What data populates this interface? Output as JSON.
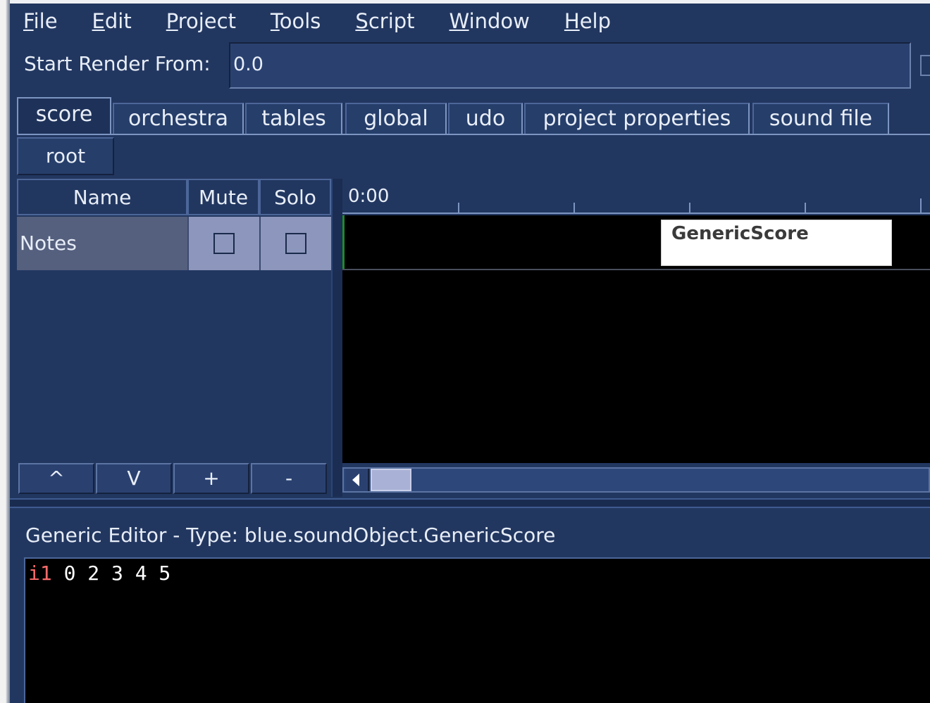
{
  "menu": {
    "items": [
      {
        "mnemonic": "F",
        "rest": "ile"
      },
      {
        "mnemonic": "E",
        "rest": "dit"
      },
      {
        "mnemonic": "P",
        "rest": "roject"
      },
      {
        "mnemonic": "T",
        "rest": "ools"
      },
      {
        "mnemonic": "S",
        "rest": "cript"
      },
      {
        "mnemonic": "W",
        "rest": "indow"
      },
      {
        "mnemonic": "H",
        "rest": "elp"
      }
    ]
  },
  "render": {
    "label": "Start Render From:",
    "value": "0.0"
  },
  "tabs": [
    "score",
    "orchestra",
    "tables",
    "global",
    "udo",
    "project properties",
    "sound file"
  ],
  "active_tab": "score",
  "breadcrumb": {
    "root": "root"
  },
  "layers": {
    "headers": {
      "name": "Name",
      "mute": "Mute",
      "solo": "Solo"
    },
    "rows": [
      {
        "name": "Notes",
        "mute": false,
        "solo": false
      }
    ],
    "buttons": {
      "up": "^",
      "down": "V",
      "add": "+",
      "remove": "-"
    }
  },
  "timeline": {
    "start_time": "0:00",
    "blocks": [
      {
        "label": "GenericScore"
      }
    ]
  },
  "editor": {
    "title": "Generic Editor - Type: blue.soundObject.GenericScore",
    "code_opcode": "i1",
    "code_args": " 0 2 3 4 5"
  },
  "colors": {
    "background": "#223760",
    "canvas": "#000000",
    "playhead": "#1f8a2a",
    "opcode": "#ff6b6b"
  }
}
